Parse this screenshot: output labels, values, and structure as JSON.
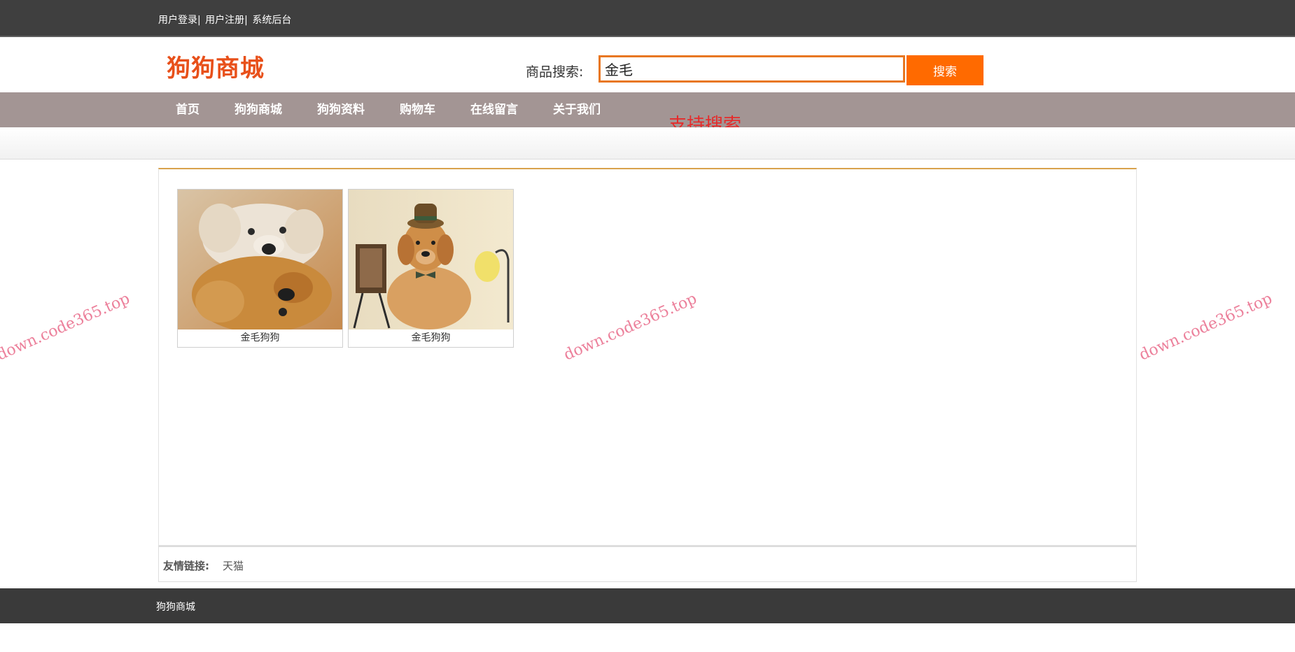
{
  "top_links": [
    "用户登录",
    "用户注册",
    "系统后台"
  ],
  "top_separator": "|",
  "logo": "狗狗商城",
  "search": {
    "label": "商品搜索:",
    "value": "金毛",
    "button": "搜索"
  },
  "nav": [
    "首页",
    "狗狗商城",
    "狗狗资料",
    "购物车",
    "在线留言",
    "关于我们"
  ],
  "annotation": "支持搜索",
  "products": [
    {
      "name": "金毛狗狗",
      "image": "golden-retriever-photo"
    },
    {
      "name": "金毛狗狗",
      "image": "golden-retriever-puppy-photo"
    }
  ],
  "friend_links": {
    "label": "友情链接:",
    "items": [
      "天猫"
    ]
  },
  "footer": "狗狗商城",
  "watermark": "down.code365.top",
  "colors": {
    "accent": "#ff6a00",
    "logo": "#e8501a",
    "nav_bg": "#a39594",
    "topbar": "#3f3f3f",
    "annotation": "#e52b2b"
  }
}
